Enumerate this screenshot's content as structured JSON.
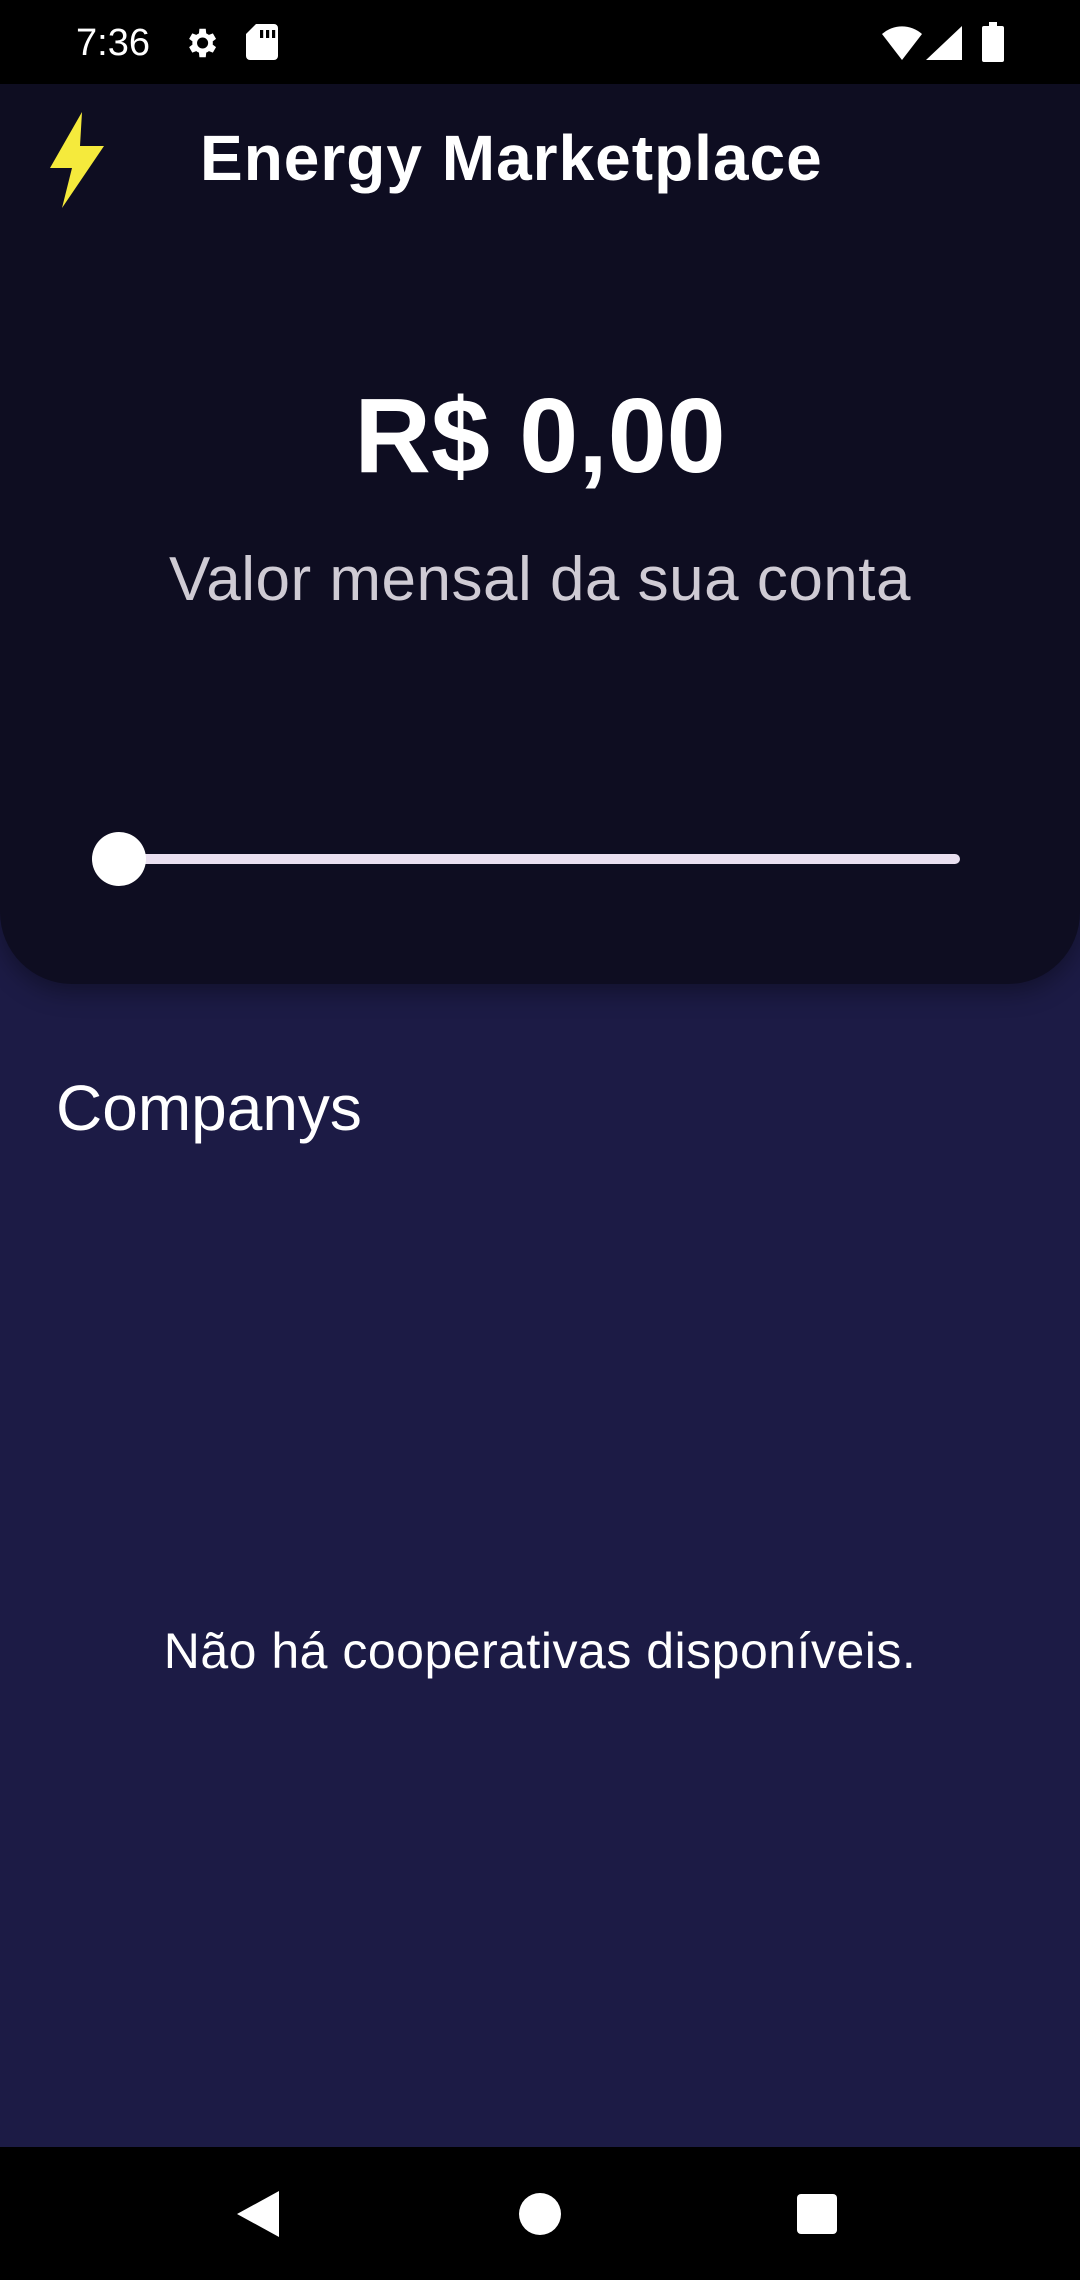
{
  "status_bar": {
    "time": "7:36",
    "icons": [
      "gear-icon",
      "sd-card-icon",
      "wifi-icon",
      "cell-signal-icon",
      "battery-icon"
    ]
  },
  "header": {
    "app_icon": "lightning-bolt-icon",
    "title": "Energy Marketplace",
    "amount": "R$ 0,00",
    "amount_caption": "Valor mensal da sua conta",
    "slider_value_fraction": 0
  },
  "companies": {
    "section_title": "Companys",
    "empty_message": "Não há cooperativas disponíveis."
  },
  "nav_bar": {
    "buttons": [
      "back-icon",
      "home-icon",
      "recents-icon"
    ]
  },
  "colors": {
    "background": "#1c1b45",
    "header_card": "#0e0d21",
    "accent_bolt": "#f5ea3c",
    "slider_track": "#e9dff0",
    "caption_text": "#cfcbd4"
  }
}
